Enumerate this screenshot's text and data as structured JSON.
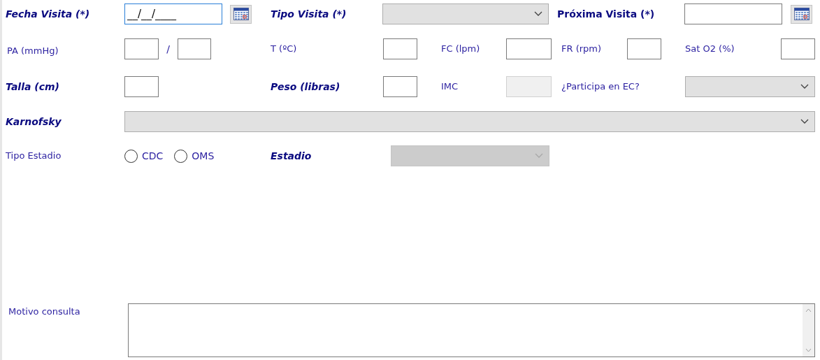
{
  "fecha_visita": {
    "label": "Fecha Visita (*)",
    "bold": true,
    "italic": true,
    "value": "__/__/____",
    "focused": true
  },
  "tipo_visita": {
    "label": "Tipo Visita (*)",
    "bold": true,
    "italic": true,
    "disabled": false
  },
  "proxima_visita": {
    "label": "Próxima Visita (*)",
    "bold": true,
    "italic": false,
    "focused": false
  },
  "pa": {
    "label": "PA (mmHg)",
    "bold": false,
    "italic": false,
    "separator": "/"
  },
  "temperatura": {
    "label": "T (ºC)",
    "bold": false,
    "italic": false
  },
  "fc": {
    "label": "FC (lpm)",
    "bold": false,
    "italic": false
  },
  "fr": {
    "label": "FR (rpm)",
    "bold": false,
    "italic": false
  },
  "sat_o2": {
    "label": "Sat O2 (%)",
    "bold": false,
    "italic": false
  },
  "talla": {
    "label": "Talla (cm)",
    "bold": true,
    "italic": true
  },
  "peso": {
    "label": "Peso (libras)",
    "bold": true,
    "italic": true
  },
  "imc": {
    "label": "IMC",
    "bold": false,
    "italic": false,
    "disabled": true
  },
  "participa_ec": {
    "label": "¿Participa en EC?",
    "bold": false,
    "italic": false,
    "disabled": false
  },
  "karnofsky": {
    "label": "Karnofsky",
    "bold": true,
    "italic": true,
    "disabled": false
  },
  "tipo_estadio": {
    "label": "Tipo Estadio",
    "bold": false,
    "italic": false,
    "options": [
      {
        "label": "CDC",
        "selected": false
      },
      {
        "label": "OMS",
        "selected": false
      }
    ]
  },
  "estadio": {
    "label": "Estadio",
    "bold": true,
    "italic": true,
    "disabled": true
  },
  "motivo_consulta": {
    "label": "Motivo consulta",
    "bold": false,
    "italic": false
  }
}
